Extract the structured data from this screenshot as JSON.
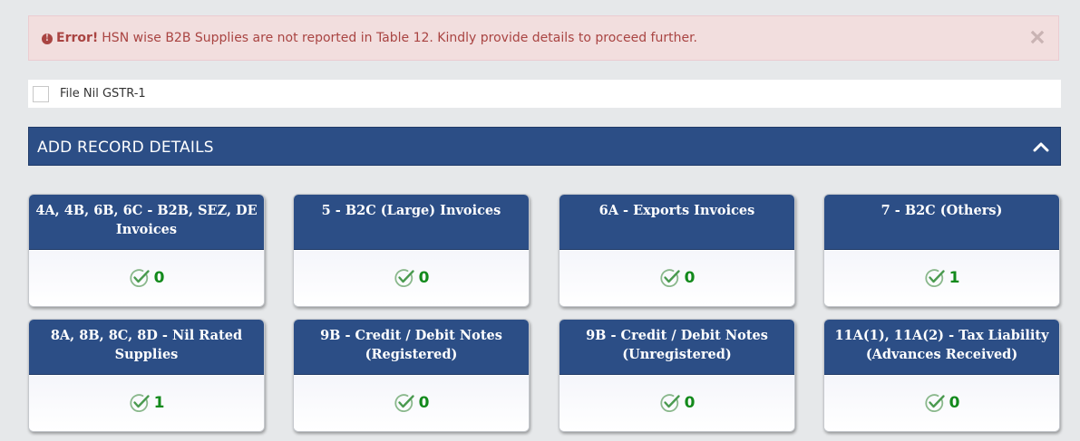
{
  "alert": {
    "icon": "exclamation-circle-icon",
    "label": "Error!",
    "message": "HSN wise B2B Supplies are not reported in Table 12. Kindly provide details to proceed further.",
    "close_icon": "close-icon",
    "colors": {
      "background": "#f2dede",
      "text": "#a94442"
    }
  },
  "nil_filing": {
    "label": "File Nil GSTR-1",
    "checked": false
  },
  "section": {
    "title": "ADD RECORD DETAILS",
    "toggle_icon": "chevron-up-icon",
    "color": "#2c4e86"
  },
  "tiles": [
    {
      "title": "4A, 4B, 6B, 6C - B2B, SEZ, DE Invoices",
      "count": "0"
    },
    {
      "title": "5 - B2C (Large) Invoices",
      "count": "0"
    },
    {
      "title": "6A - Exports Invoices",
      "count": "0"
    },
    {
      "title": "7 - B2C (Others)",
      "count": "1"
    },
    {
      "title": "8A, 8B, 8C, 8D - Nil Rated Supplies",
      "count": "1"
    },
    {
      "title": "9B - Credit / Debit Notes (Registered)",
      "count": "0"
    },
    {
      "title": "9B - Credit / Debit Notes (Unregistered)",
      "count": "0"
    },
    {
      "title": "11A(1), 11A(2) - Tax Liability (Advances Received)",
      "count": "0"
    }
  ],
  "tile_icon": "check-circle-icon",
  "count_color": "#138a1c"
}
